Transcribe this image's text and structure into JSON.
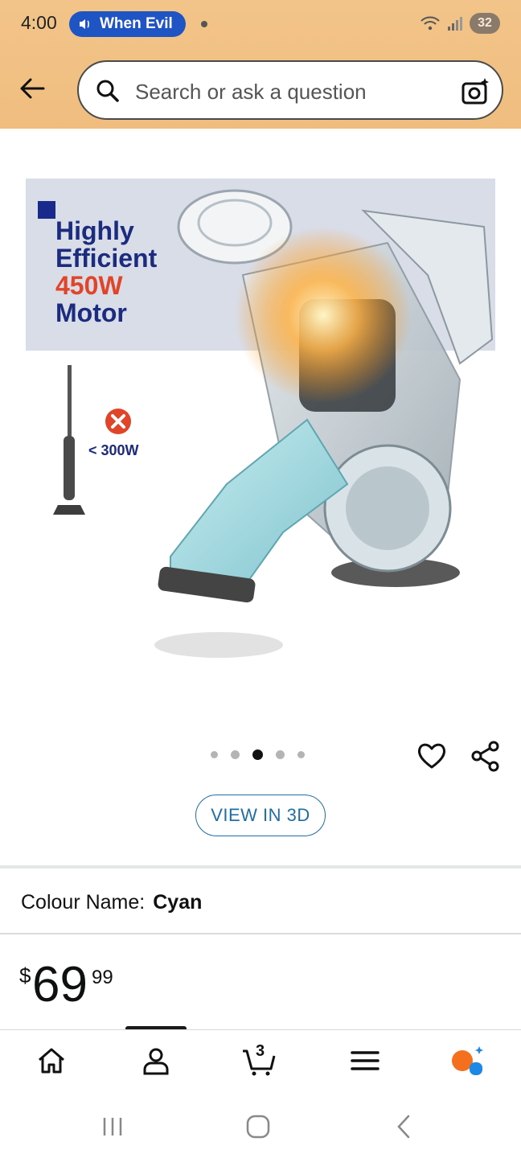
{
  "status_bar": {
    "time": "4:00",
    "media_title": "When Evil",
    "battery": "32"
  },
  "search": {
    "placeholder": "Search or ask a question"
  },
  "product_image": {
    "headline_line1": "Highly",
    "headline_line2": "Efficient",
    "headline_watt": "450W",
    "headline_line4": "Motor",
    "comparison_label": "< 300W"
  },
  "carousel": {
    "total": 5,
    "active_index": 3
  },
  "view_3d_label": "VIEW IN 3D",
  "colour": {
    "label": "Colour Name:",
    "value": "Cyan"
  },
  "price": {
    "symbol": "$",
    "whole": "69",
    "fraction": "99"
  },
  "cart_count": "3",
  "colors": {
    "header_bg": "#f0bd7f",
    "accent_blue": "#1f6ea3",
    "promo_navy": "#1b2b7e",
    "promo_red": "#e0452a",
    "assistant_orange": "#f4701e",
    "assistant_blue": "#1e88e5"
  }
}
